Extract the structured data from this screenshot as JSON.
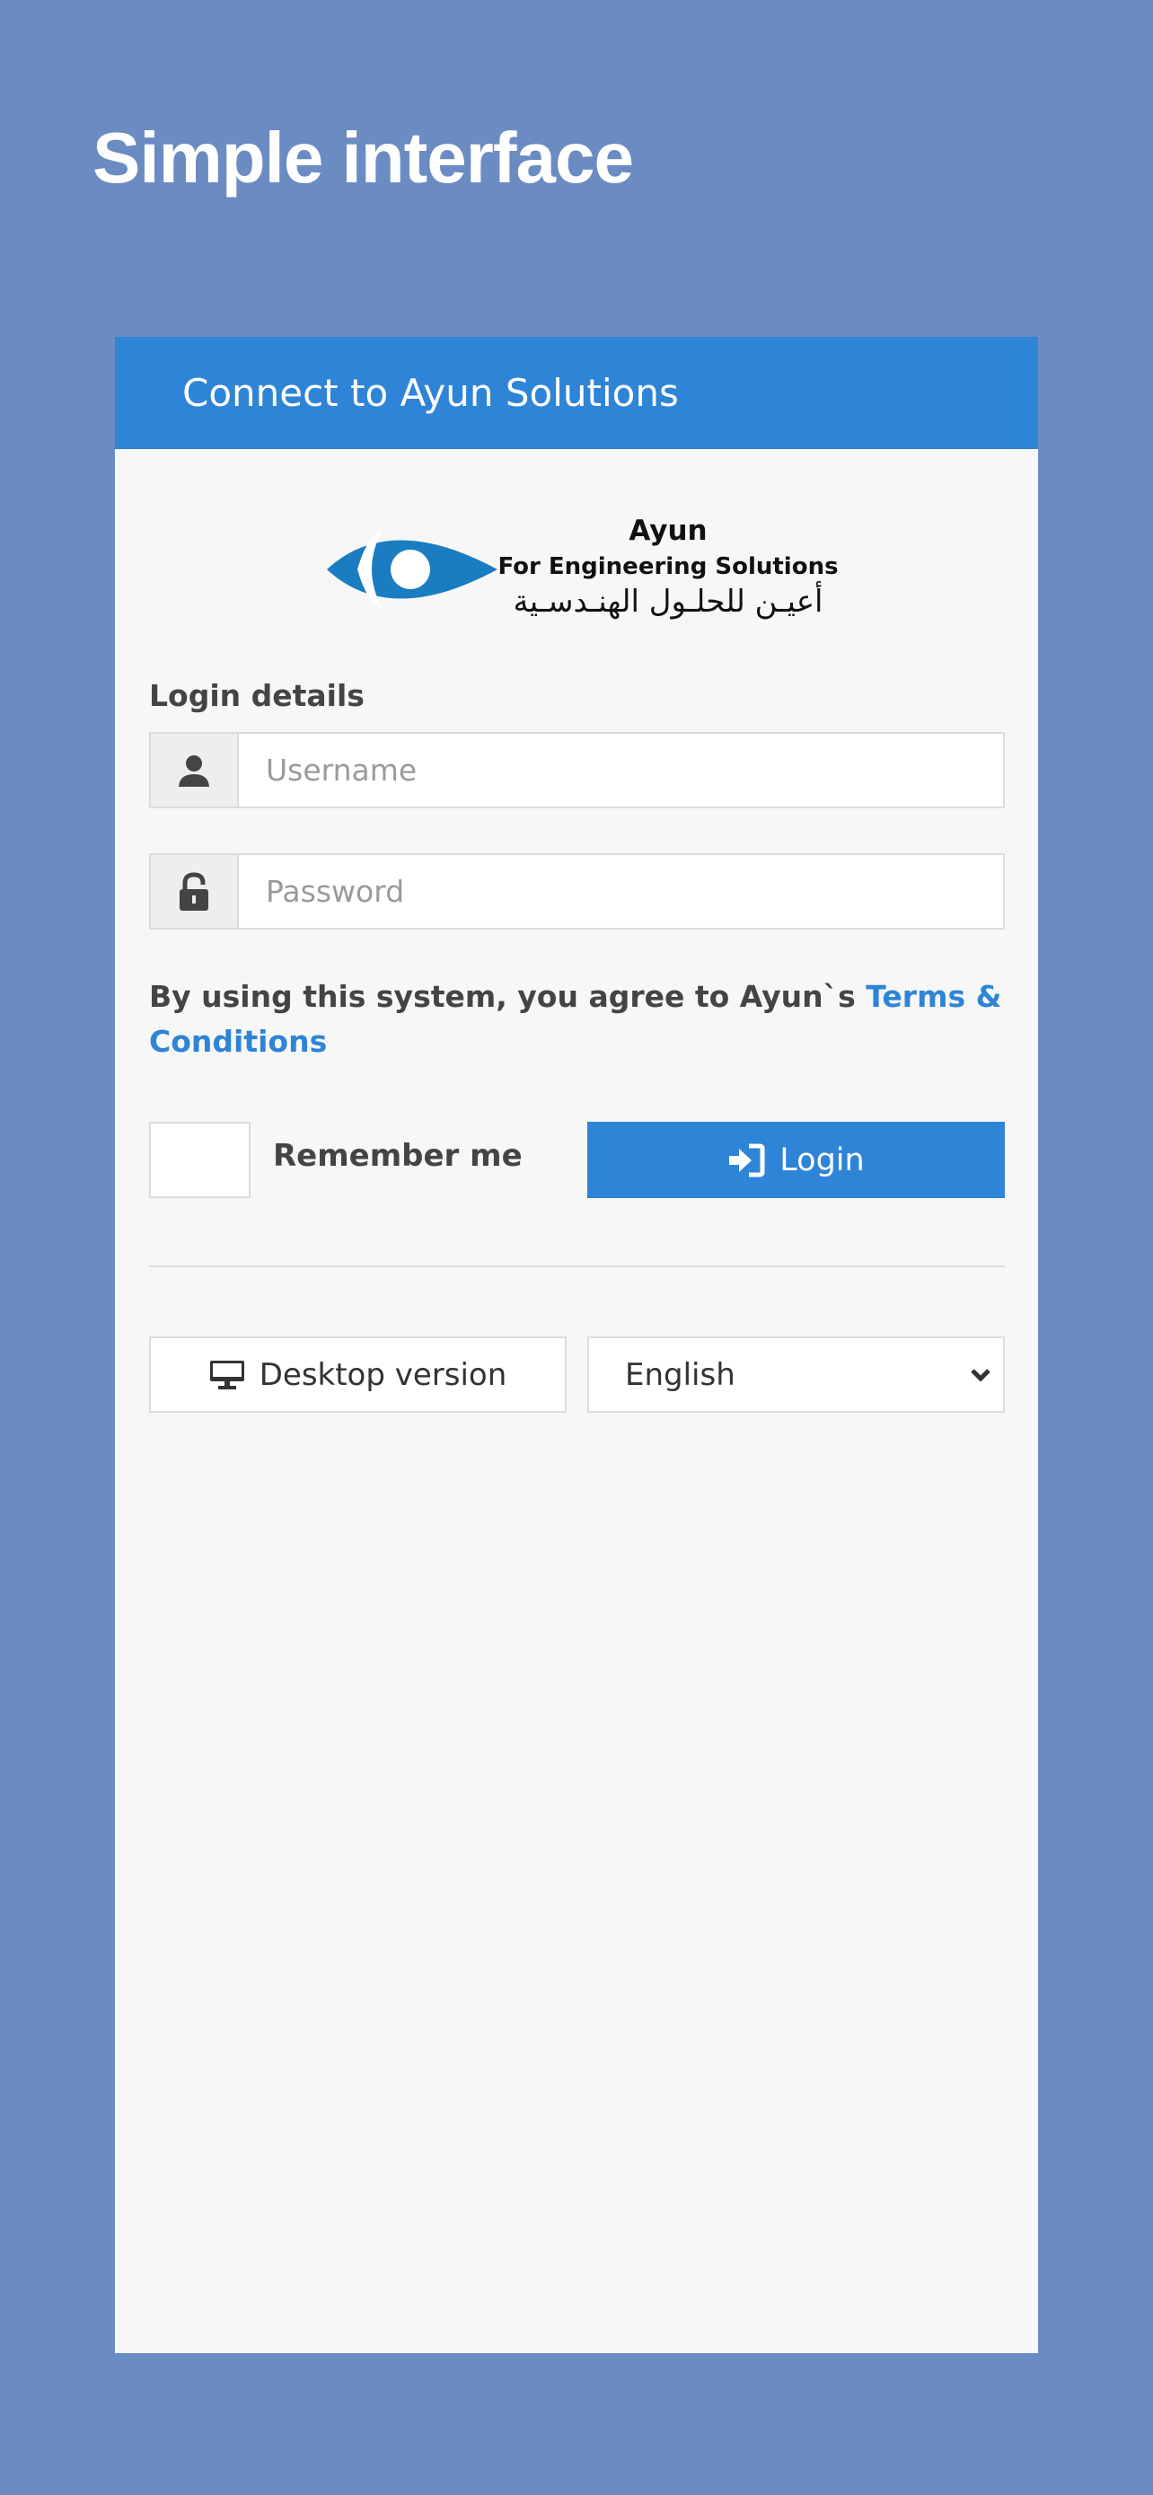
{
  "headline": "Simple interface",
  "card": {
    "header_title": "Connect to Ayun Solutions",
    "logo": {
      "name": "Ayun",
      "tagline": "For Engineering Solutions",
      "arabic": "أعيـن للحلـول الهنـدسـية",
      "icon": "eye-logo-icon",
      "color": "#1a7cc1"
    },
    "section_label": "Login details",
    "username": {
      "placeholder": "Username",
      "value": "",
      "icon": "user-icon"
    },
    "password": {
      "placeholder": "Password",
      "value": "",
      "icon": "lock-icon"
    },
    "terms": {
      "text": "By using this system, you agree to Ayun`s ",
      "link_label": "Terms & Conditions"
    },
    "remember_label": "Remember me",
    "login_label": "Login",
    "login_icon": "sign-in-icon",
    "desktop_label": "Desktop version",
    "desktop_icon": "monitor-icon",
    "language": {
      "selected": "English",
      "icon": "chevron-down-icon"
    }
  },
  "colors": {
    "background": "#6b8bc3",
    "accent": "#2e84d6",
    "card": "#f7f7f7"
  }
}
